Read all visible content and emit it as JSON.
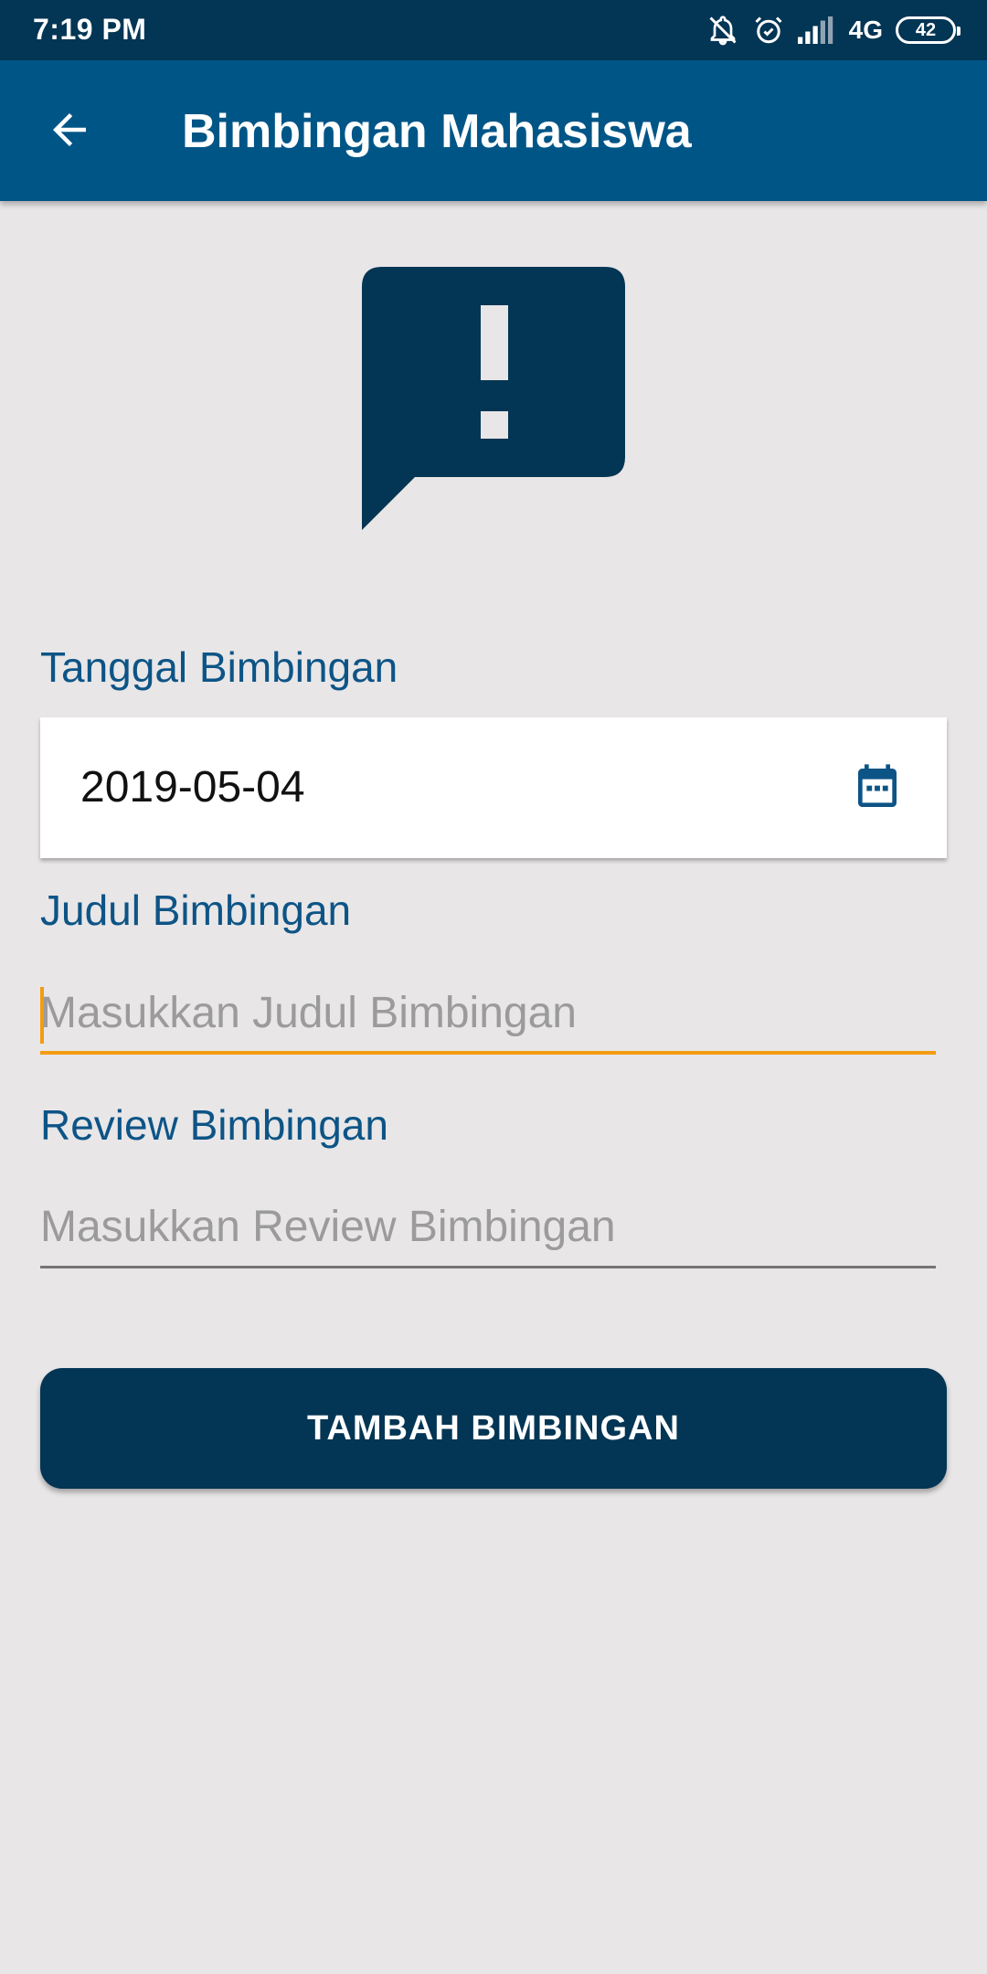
{
  "status_bar": {
    "time": "7:19 PM",
    "network": "4G",
    "battery": "42",
    "icons": [
      "notifications-off-icon",
      "alarm-icon",
      "signal-icon",
      "battery-icon"
    ]
  },
  "app_bar": {
    "title": "Bimbingan Mahasiswa",
    "back_icon": "arrow-back-icon"
  },
  "hero": {
    "icon": "feedback-alert-icon"
  },
  "form": {
    "date_label": "Tanggal Bimbingan",
    "date_value": "2019-05-04",
    "date_icon": "calendar-icon",
    "title_label": "Judul Bimbingan",
    "title_placeholder": "Masukkan Judul Bimbingan",
    "title_value": "",
    "review_label": "Review Bimbingan",
    "review_placeholder": "Masukkan Review Bimbingan",
    "review_value": "",
    "submit_label": "TAMBAH BIMBINGAN"
  },
  "colors": {
    "status_bar": "#033554",
    "app_bar": "#005587",
    "background": "#e8e6e7",
    "label": "#0d5486",
    "focus_accent": "#f39c12",
    "button": "#033554"
  }
}
